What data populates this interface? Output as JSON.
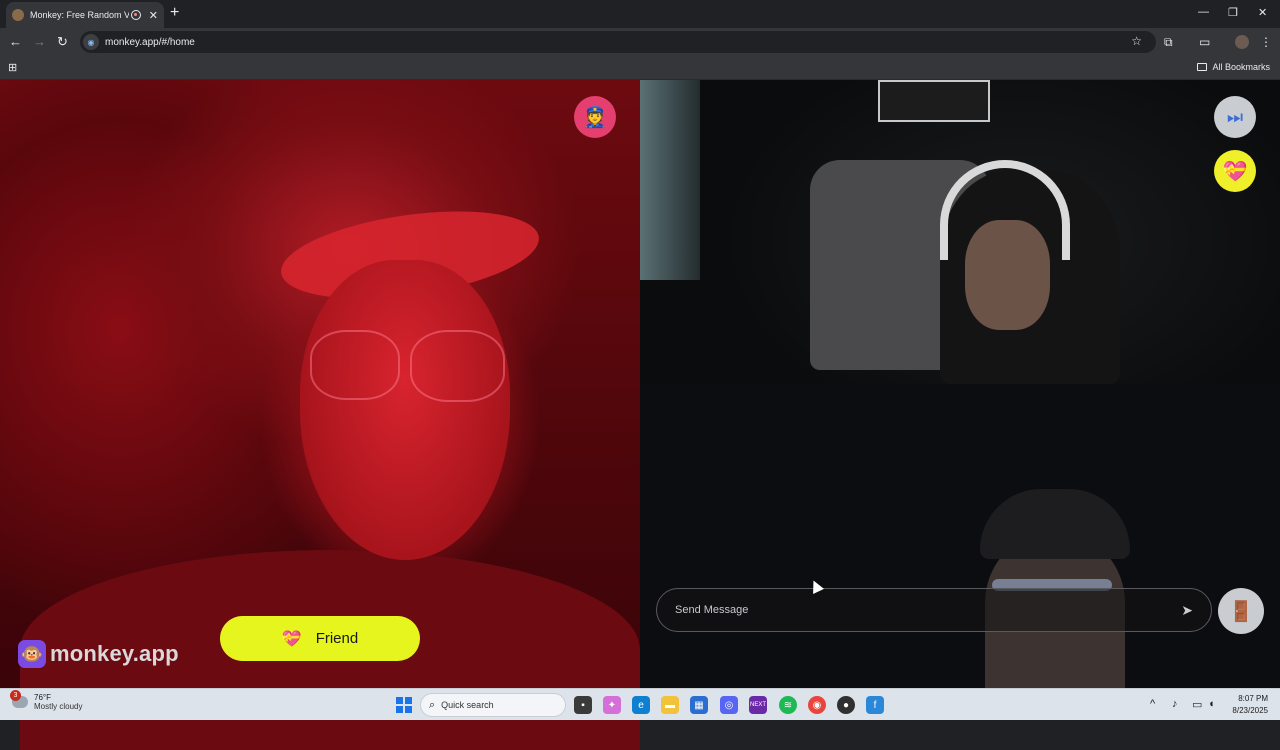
{
  "browser": {
    "tab_title": "Monkey: Free Random Video Chat",
    "tab_close": "✕",
    "new_tab": "+",
    "url": "monkey.app/#/home",
    "all_bookmarks": "All Bookmarks",
    "window_controls": [
      "—",
      "❐",
      "✕"
    ]
  },
  "chat": {
    "report_icon": "👮",
    "skip_icon": "⏭",
    "heart_icon": "💝",
    "friend_label": "Friend",
    "friend_icon": "💝",
    "message_placeholder": "Send Message",
    "send_icon": "➤",
    "exit_icon": "🚪",
    "brand_name": "monkey.app",
    "brand_icon": "🐵"
  },
  "taskbar": {
    "weather_temp": "76°F",
    "weather_condition": "Mostly cloudy",
    "weather_badge": "3",
    "search_label": "Quick search",
    "time": "8:07 PM",
    "date": "8/23/2025",
    "apps": [
      "file-explorer",
      "copilot",
      "edge",
      "folder",
      "store",
      "discord",
      "next",
      "spotify",
      "chrome",
      "obs",
      "word"
    ]
  },
  "colors": {
    "friend_button": "#e7f51f",
    "report_button": "#e43f6f",
    "heart_button": "#efef2a",
    "brand_logo": "#7b4ae2"
  }
}
